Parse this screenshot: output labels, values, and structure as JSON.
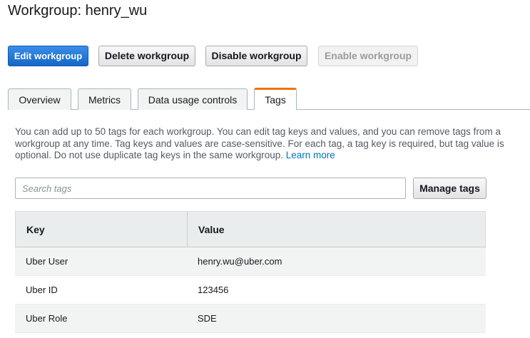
{
  "page": {
    "title": "Workgroup: henry_wu"
  },
  "actions": {
    "edit": "Edit workgroup",
    "delete": "Delete workgroup",
    "disable": "Disable workgroup",
    "enable": "Enable workgroup"
  },
  "tabs": [
    {
      "label": "Overview",
      "active": false
    },
    {
      "label": "Metrics",
      "active": false
    },
    {
      "label": "Data usage controls",
      "active": false
    },
    {
      "label": "Tags",
      "active": true
    }
  ],
  "tags_panel": {
    "description": "You can add up to 50 tags for each workgroup. You can edit tag keys and values, and you can remove tags from a workgroup at any time. Tag keys and values are case-sensitive. For each tag, a tag key is required, but tag value is optional. Do not use duplicate tag keys in the same workgroup.",
    "learn_more": "Learn more",
    "search_placeholder": "Search tags",
    "search_value": "",
    "manage_button": "Manage tags",
    "columns": {
      "key": "Key",
      "value": "Value"
    },
    "rows": [
      {
        "key": "Uber User",
        "value": "henry.wu@uber.com"
      },
      {
        "key": "Uber ID",
        "value": "123456"
      },
      {
        "key": "Uber Role",
        "value": "SDE"
      }
    ]
  },
  "colors": {
    "primary": "#1567c8",
    "active_tab_accent": "#ec7211",
    "link": "#0073bb"
  }
}
